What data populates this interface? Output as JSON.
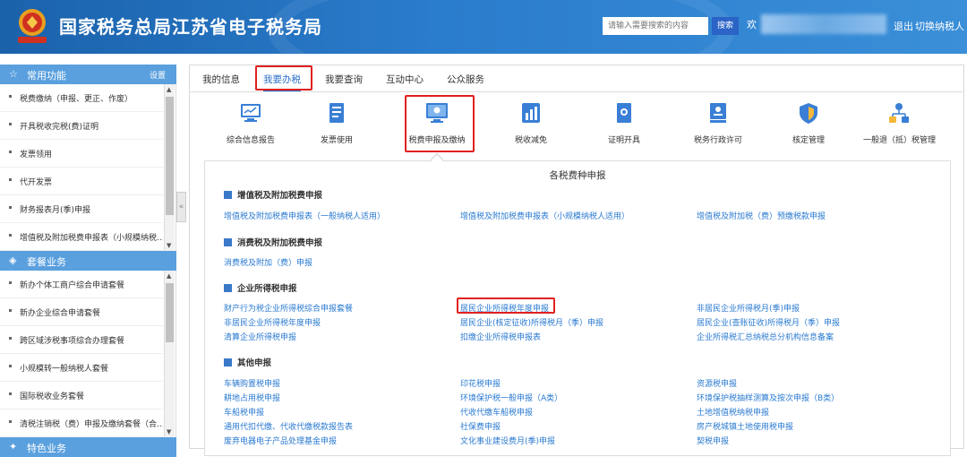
{
  "header": {
    "title": "国家税务总局江苏省电子税务局",
    "search_placeholder": "请输入需要搜索的内容",
    "search_button": "搜索",
    "welcome": "欢",
    "logout": "退出",
    "switch_taxpayer": "切换纳税人"
  },
  "sidebar": {
    "common_title": "常用功能",
    "settings": "设置",
    "common_items": [
      "税费缴纳（申报、更正、作废）",
      "开具税收完税(费)证明",
      "发票领用",
      "代开发票",
      "财务报表月(季)申报",
      "增值税及附加税费申报表（小规模纳税..."
    ],
    "package_title": "套餐业务",
    "package_items": [
      "新办个体工商户综合申请套餐",
      "新办企业综合申请套餐",
      "跨区域涉税事项综合办理套餐",
      "小规模转一般纳税人套餐",
      "国际税收业务套餐",
      "清税注销税（费）申报及缴纳套餐（合..."
    ],
    "special_title": "特色业务"
  },
  "tabs": [
    "我的信息",
    "我要办税",
    "我要查询",
    "互动中心",
    "公众服务"
  ],
  "functions": [
    {
      "label": "综合信息报告",
      "icon": "chart-monitor-icon"
    },
    {
      "label": "发票使用",
      "icon": "document-icon"
    },
    {
      "label": "税费申报及缴纳",
      "icon": "monitor-icon"
    },
    {
      "label": "税收减免",
      "icon": "bar-chart-icon"
    },
    {
      "label": "证明开具",
      "icon": "certificate-icon"
    },
    {
      "label": "税务行政许可",
      "icon": "license-icon"
    },
    {
      "label": "核定管理",
      "icon": "shield-icon"
    },
    {
      "label": "一般退（抵）税管理",
      "icon": "flow-icon"
    }
  ],
  "panel": {
    "title": "各税费种申报",
    "vat": {
      "title": "增值税及附加税费申报",
      "links": [
        "增值税及附加税费申报表（一般纳税人适用）",
        "增值税及附加税费申报表（小规模纳税人适用）",
        "增值税及附加税（费）预缴税款申报"
      ]
    },
    "consumption": {
      "title": "消费税及附加税费申报",
      "links": [
        "消费税及附加（费）申报"
      ]
    },
    "cit": {
      "title": "企业所得税申报",
      "links": [
        "财产行为税企业所得税综合申报套餐",
        "居民企业所得税年度申报",
        "非居民企业所得税月(季)申报",
        "非居民企业所得税年度申报",
        "居民企业(核定征收)所得税月（季）申报",
        "居民企业(查账征收)所得税月（季）申报",
        "清算企业所得税申报",
        "扣缴企业所得税申报表",
        "企业所得税汇总纳税总分机构信息备案"
      ]
    },
    "other": {
      "title": "其他申报",
      "links": [
        "车辆购置税申报",
        "印花税申报",
        "资源税申报",
        "耕地占用税申报",
        "环境保护税一般申报（A类）",
        "环境保护税抽样测算及按次申报（B类）",
        "车船税申报",
        "代收代缴车船税申报",
        "土地增值税纳税申报",
        "通用代扣代缴、代收代缴税款报告表",
        "社保费申报",
        "房产税城镇土地使用税申报",
        "废弃电器电子产品处理基金申报",
        "文化事业建设费月(季)申报",
        "契税申报"
      ]
    }
  },
  "colors": {
    "header_blue": "#2a7ccc",
    "sidebar_head": "#5aa0de",
    "link_blue": "#2a7ad0",
    "highlight_red": "#e02020"
  }
}
